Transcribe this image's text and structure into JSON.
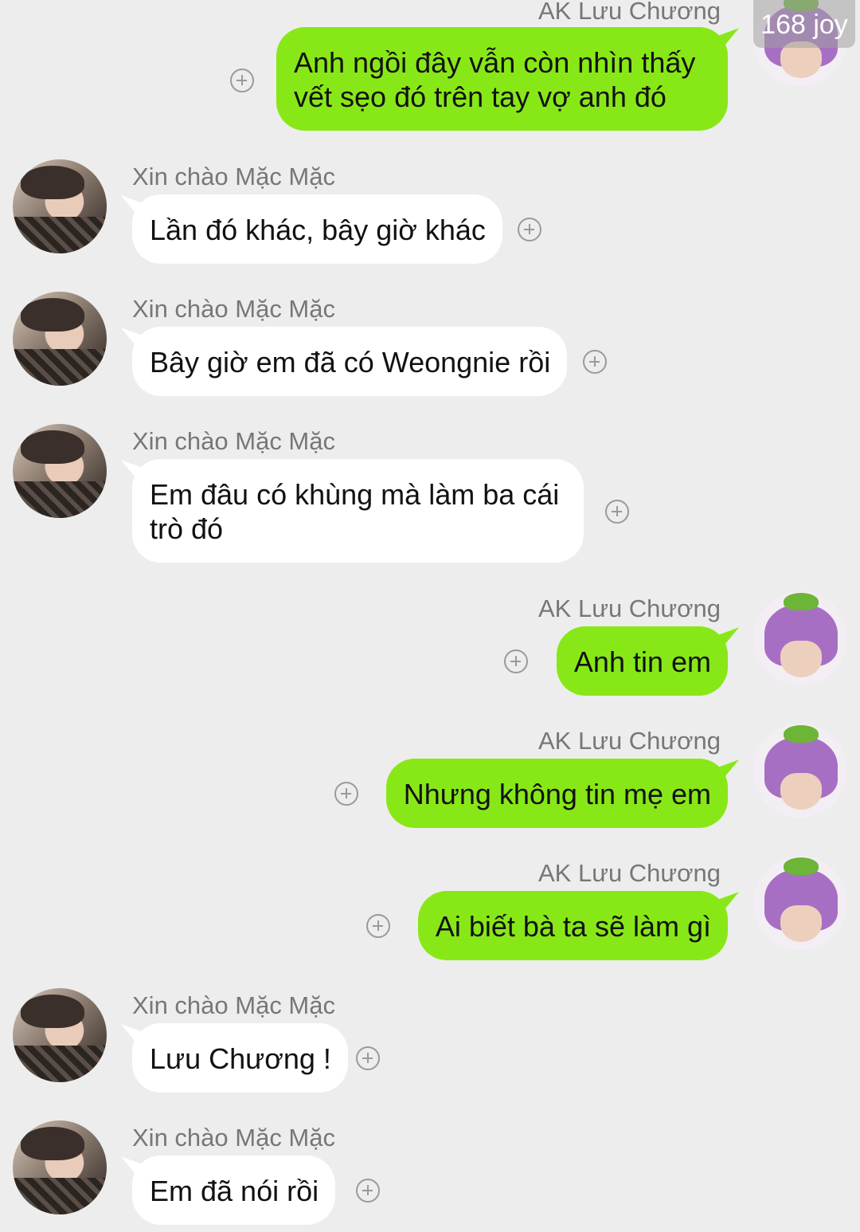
{
  "watermark": "168 joy",
  "contacts": {
    "me": "AK Lưu Chương",
    "other": "Xin chào Mặc Mặc"
  },
  "messages": [
    {
      "side": "out",
      "sender": "AK Lưu Chương",
      "text": "Anh ngồi đây vẫn còn nhìn thấy vết sẹo đó trên tay vợ anh đó"
    },
    {
      "side": "in",
      "sender": "Xin chào Mặc Mặc",
      "text": "Lần đó khác, bây giờ khác"
    },
    {
      "side": "in",
      "sender": "Xin chào Mặc Mặc",
      "text": "Bây giờ em đã có Weongnie rồi"
    },
    {
      "side": "in",
      "sender": "Xin chào Mặc Mặc",
      "text": "Em đâu có khùng mà làm ba cái trò đó"
    },
    {
      "side": "out",
      "sender": "AK Lưu Chương",
      "text": "Anh tin em"
    },
    {
      "side": "out",
      "sender": "AK Lưu Chương",
      "text": "Nhưng không tin mẹ em"
    },
    {
      "side": "out",
      "sender": "AK Lưu Chương",
      "text": "Ai biết bà ta sẽ làm gì"
    },
    {
      "side": "in",
      "sender": "Xin chào Mặc Mặc",
      "text": "Lưu Chương !"
    },
    {
      "side": "in",
      "sender": "Xin chào Mặc Mặc",
      "text": "Em đã nói rồi"
    }
  ],
  "colors": {
    "background": "#ededed",
    "outgoing_bubble": "#88e817",
    "incoming_bubble": "#ffffff"
  },
  "icons": {
    "reaction": "plus-circle-icon",
    "me_avatar": "eggplant-hat-avatar",
    "other_avatar": "profile-photo-avatar"
  }
}
